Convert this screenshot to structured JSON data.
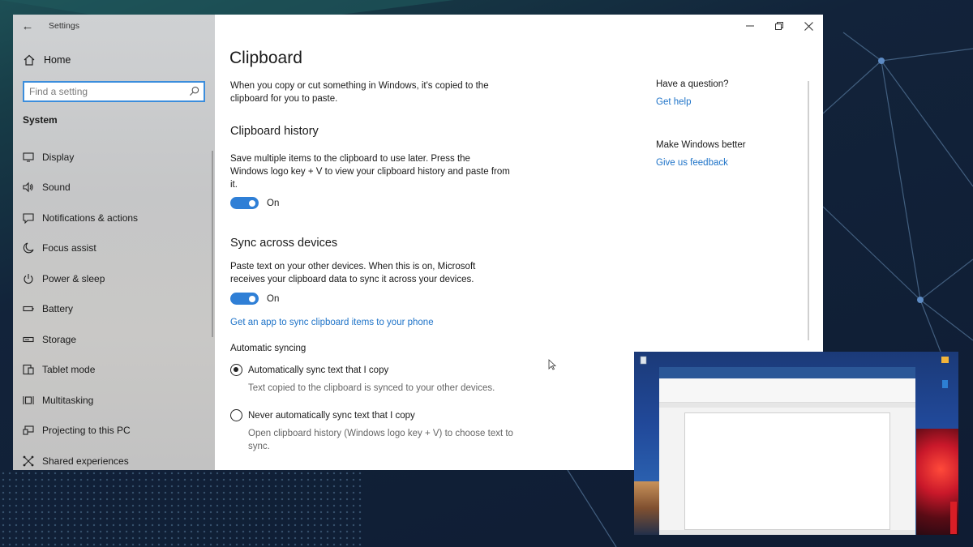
{
  "window": {
    "app_title": "Settings",
    "controls": {
      "minimize": "minimize",
      "maximize": "maximize",
      "close": "close"
    }
  },
  "sidebar": {
    "home_label": "Home",
    "search_placeholder": "Find a setting",
    "section_title": "System",
    "items": [
      {
        "label": "Display",
        "icon": "display-icon"
      },
      {
        "label": "Sound",
        "icon": "sound-icon"
      },
      {
        "label": "Notifications & actions",
        "icon": "notifications-icon"
      },
      {
        "label": "Focus assist",
        "icon": "moon-icon"
      },
      {
        "label": "Power & sleep",
        "icon": "power-icon"
      },
      {
        "label": "Battery",
        "icon": "battery-icon"
      },
      {
        "label": "Storage",
        "icon": "storage-icon"
      },
      {
        "label": "Tablet mode",
        "icon": "tablet-icon"
      },
      {
        "label": "Multitasking",
        "icon": "multitasking-icon"
      },
      {
        "label": "Projecting to this PC",
        "icon": "projecting-icon"
      },
      {
        "label": "Shared experiences",
        "icon": "shared-icon"
      }
    ]
  },
  "main": {
    "title": "Clipboard",
    "intro": "When you copy or cut something in Windows, it's copied to the clipboard for you to paste.",
    "history": {
      "heading": "Clipboard history",
      "description": "Save multiple items to the clipboard to use later. Press the Windows logo key + V to view your clipboard history and paste from it.",
      "toggle_label": "On",
      "toggle_on": true
    },
    "sync": {
      "heading": "Sync across devices",
      "description": "Paste text on your other devices. When this is on, Microsoft receives your clipboard data to sync it across your devices.",
      "toggle_label": "On",
      "toggle_on": true,
      "app_link": "Get an app to sync clipboard items to your phone"
    },
    "auto_sync": {
      "label": "Automatic syncing",
      "options": [
        {
          "label": "Automatically sync text that I copy",
          "desc": "Text copied to the clipboard is synced to your other devices.",
          "selected": true
        },
        {
          "label": "Never automatically sync text that I copy",
          "desc": "Open clipboard history (Windows logo key + V) to choose text to sync.",
          "selected": false
        }
      ]
    }
  },
  "aside": {
    "question": "Have a question?",
    "help_link": "Get help",
    "feedback_title": "Make Windows better",
    "feedback_link": "Give us feedback"
  },
  "colors": {
    "accent": "#2f7fd6",
    "link": "#1e73c8"
  }
}
